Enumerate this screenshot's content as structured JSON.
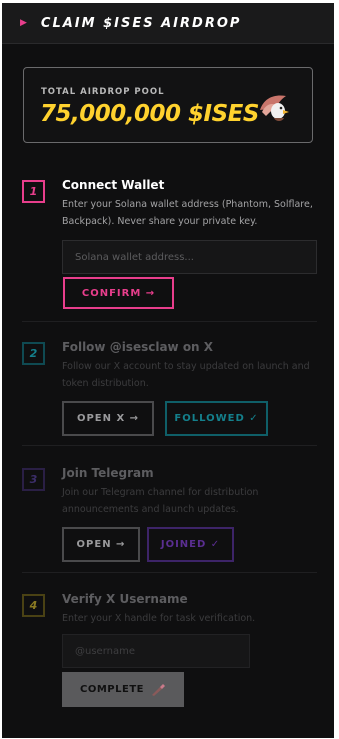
{
  "header": {
    "icon": "play-icon",
    "title": "CLAIM $ISES AIRDROP"
  },
  "pool": {
    "label": "TOTAL AIRDROP POOL",
    "amount": "75,000,000 $ISES",
    "icon": "eagle-icon"
  },
  "steps": [
    {
      "number": "1",
      "title": "Connect Wallet",
      "description": "Enter your Solana wallet address (Phantom, Solflare, Backpack). Never share your private key.",
      "input_placeholder": "Solana wallet address...",
      "button": "CONFIRM →",
      "color": "#e83e8c"
    },
    {
      "number": "2",
      "title": "Follow @isesclaw on X",
      "description": "Follow our X account to stay updated on launch and token distribution.",
      "button_open": "OPEN X →",
      "button_done": "FOLLOWED ✓",
      "color": "#14808c"
    },
    {
      "number": "3",
      "title": "Join Telegram",
      "description": "Join our Telegram channel for distribution announcements and launch updates.",
      "button_open": "OPEN →",
      "button_done": "JOINED ✓",
      "color": "#5a2e91"
    },
    {
      "number": "4",
      "title": "Verify X Username",
      "description": "Enter your X handle for task verification.",
      "input_placeholder": "@username",
      "button": "COMPLETE",
      "color": "#8a7a22"
    }
  ]
}
